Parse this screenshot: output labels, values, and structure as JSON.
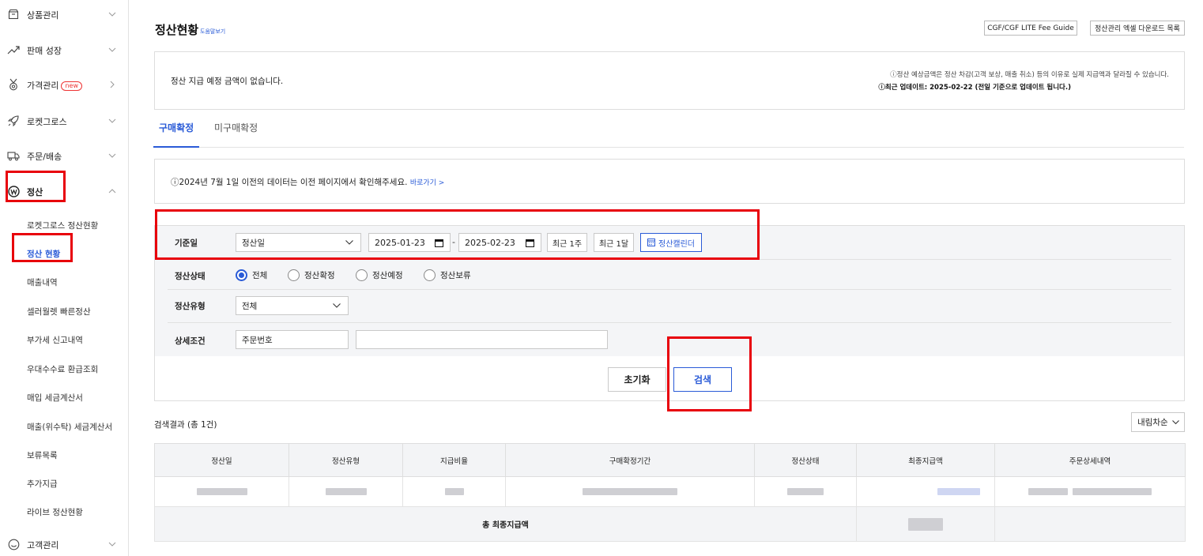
{
  "sidebar": {
    "items": [
      {
        "label": "상품관리",
        "icon": "box-icon"
      },
      {
        "label": "판매 성장",
        "icon": "trend-up-icon"
      },
      {
        "label": "가격관리",
        "icon": "medal-icon",
        "badge": "new"
      },
      {
        "label": "로켓그로스",
        "icon": "rocket-icon"
      },
      {
        "label": "주문/배송",
        "icon": "truck-icon"
      },
      {
        "label": "정산",
        "icon": "won-icon"
      },
      {
        "label": "고객관리",
        "icon": "smile-icon"
      }
    ],
    "sub_items": [
      {
        "label": "로켓그로스 정산현황"
      },
      {
        "label": "정산 현황"
      },
      {
        "label": "매출내역"
      },
      {
        "label": "셀러월렛 빠른정산"
      },
      {
        "label": "부가세 신고내역"
      },
      {
        "label": "우대수수료 환급조회"
      },
      {
        "label": "매입 세금계산서"
      },
      {
        "label": "매출(위수탁) 세금계산서"
      },
      {
        "label": "보류목록"
      },
      {
        "label": "추가지급"
      },
      {
        "label": "라이브 정산현황"
      }
    ]
  },
  "header": {
    "title": "정산현황",
    "help_link": "도움말보기",
    "fee_guide_button": "CGF/CGF LITE Fee Guide",
    "excel_download_button": "정산관리 엑셀 다운로드 목록"
  },
  "notice": {
    "main_text": "정산 지급 예정 금액이 없습니다.",
    "info_line": "ⓘ정산 예상금액은 정산 차감(고객 보상, 매출 취소) 등의 이유로 실제 지급액과 달라질 수 있습니다.",
    "update_line": "ⓘ최근 업데이트: 2025-02-22 (전일 기준으로 업데이트 됩니다.)"
  },
  "tabs": [
    {
      "label": "구매확정"
    },
    {
      "label": "미구매확정"
    }
  ],
  "info_box": {
    "text": "ⓘ2024년 7월 1일 이전의 데이터는 이전 페이지에서 확인해주세요.",
    "link": "바로가기 >"
  },
  "filter": {
    "base_date": {
      "label": "기준일",
      "select_value": "정산일",
      "start_date": "2025-01-23",
      "separator": "-",
      "end_date": "2025-02-23",
      "recent_week_button": "최근 1주",
      "recent_month_button": "최근 1달",
      "calendar_button": "정산캘린더"
    },
    "status": {
      "label": "정산상태",
      "options": [
        "전체",
        "정산확정",
        "정산예정",
        "정산보류"
      ],
      "selected": "전체"
    },
    "type": {
      "label": "정산유형",
      "select_value": "전체"
    },
    "detail": {
      "label": "상세조건",
      "select_value": "주문번호",
      "input_value": ""
    },
    "reset_button": "초기화",
    "search_button": "검색"
  },
  "results": {
    "title": "검색결과 (총 1건)",
    "sort": "내림차순",
    "columns": [
      "정산일",
      "정산유형",
      "지급비율",
      "구매확정기간",
      "정산상태",
      "최종지급액",
      "주문상세내역"
    ],
    "total_label": "총 최종지급액"
  },
  "colors": {
    "accent": "#2a5bd7",
    "highlight_box": "#e8000b"
  }
}
